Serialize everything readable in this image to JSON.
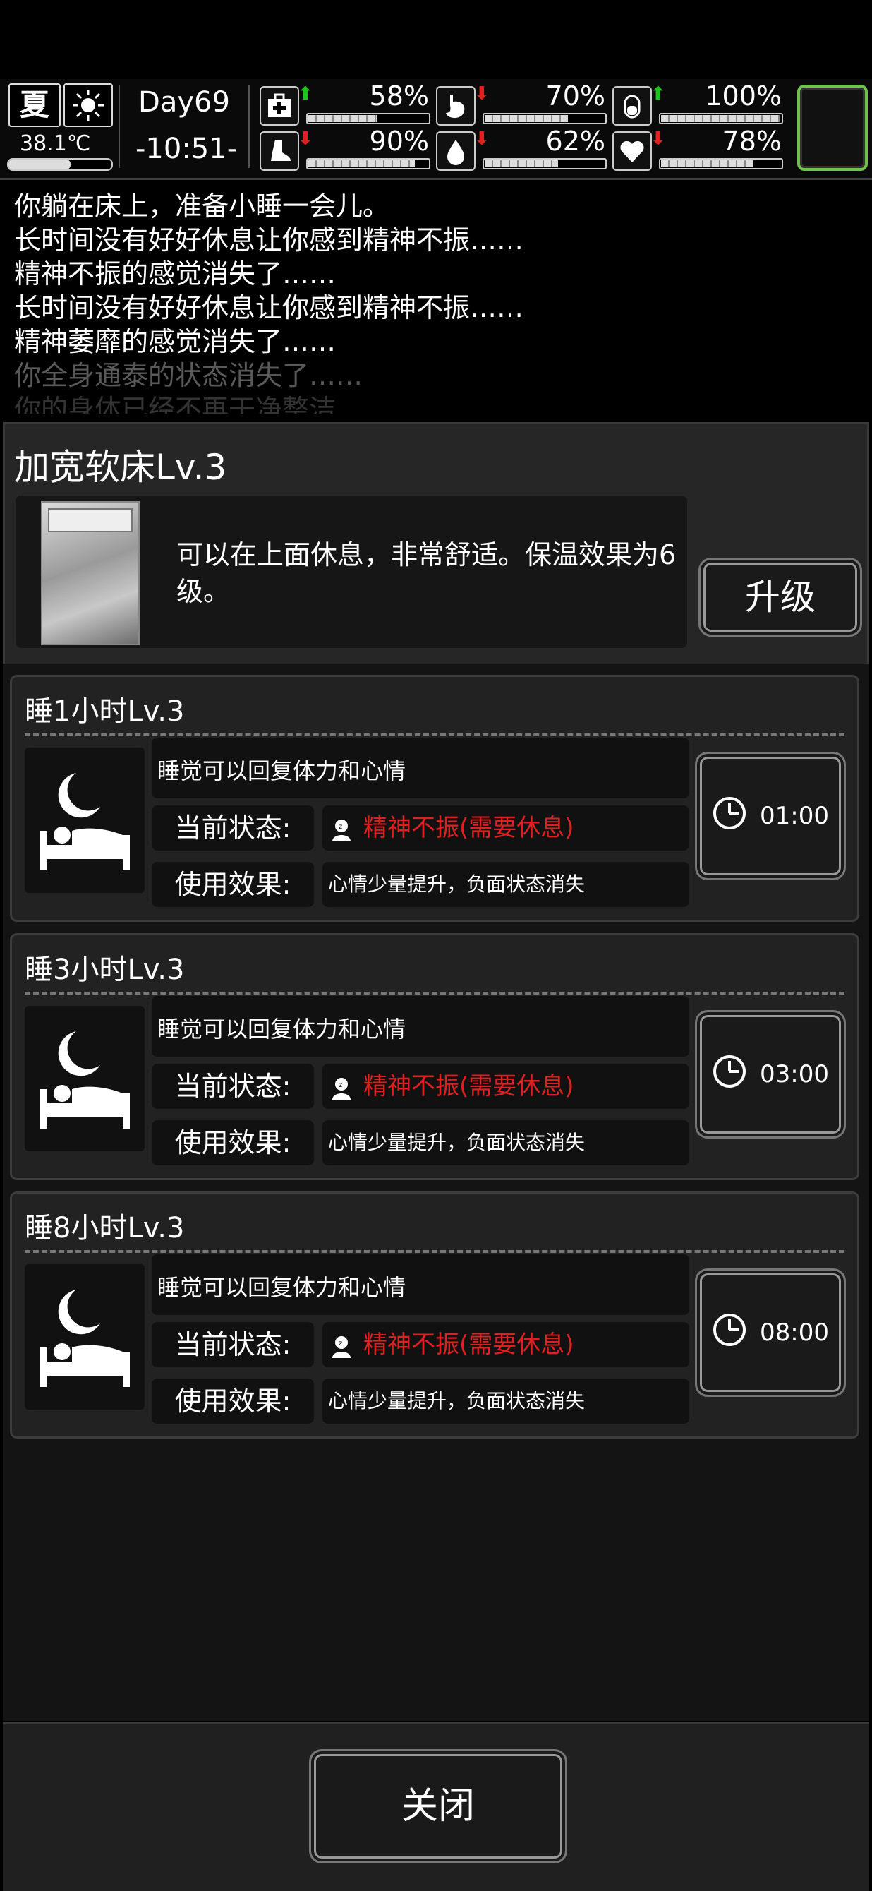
{
  "status": {
    "season": "夏",
    "weather_icon": "sun-icon",
    "temperature": "38.1℃",
    "temperature_level": 0.6,
    "day": "Day69",
    "time": "-10:51-",
    "stats": [
      {
        "icon": "medkit-icon",
        "trend": "up",
        "value": "58%",
        "level": 0.58
      },
      {
        "icon": "stomach-icon",
        "trend": "down",
        "value": "70%",
        "level": 0.7
      },
      {
        "icon": "bladder-icon",
        "trend": "up",
        "value": "100%",
        "level": 1.0
      },
      {
        "icon": "foot-icon",
        "trend": "down",
        "value": "90%",
        "level": 0.9
      },
      {
        "icon": "water-drop-icon",
        "trend": "down",
        "value": "62%",
        "level": 0.62
      },
      {
        "icon": "heart-icon",
        "trend": "down",
        "value": "78%",
        "level": 0.78
      }
    ],
    "trend_up": "⬆",
    "trend_down": "⬇"
  },
  "log": {
    "lines": [
      "你躺在床上，准备小睡一会儿。",
      "长时间没有好好休息让你感到精神不振……",
      "精神不振的感觉消失了……",
      "长时间没有好好休息让你感到精神不振……",
      "精神萎靡的感觉消失了……",
      "你全身通泰的状态消失了……",
      "你的身体已经不再干净整洁……"
    ]
  },
  "item": {
    "title": "加宽软床Lv.3",
    "description": "可以在上面休息，非常舒适。保温效果为6级。",
    "upgrade_label": "升级"
  },
  "actions": [
    {
      "name": "睡1小时Lv.3",
      "desc": "睡觉可以回复体力和心情",
      "status_label": "当前状态:",
      "status_value": "精神不振(需要休息)",
      "effect_label": "使用效果:",
      "effect_value": "心情少量提升，负面状态消失",
      "time": "01:00"
    },
    {
      "name": "睡3小时Lv.3",
      "desc": "睡觉可以回复体力和心情",
      "status_label": "当前状态:",
      "status_value": "精神不振(需要休息)",
      "effect_label": "使用效果:",
      "effect_value": "心情少量提升，负面状态消失",
      "time": "03:00"
    },
    {
      "name": "睡8小时Lv.3",
      "desc": "睡觉可以回复体力和心情",
      "status_label": "当前状态:",
      "status_value": "精神不振(需要休息)",
      "effect_label": "使用效果:",
      "effect_value": "心情少量提升，负面状态消失",
      "time": "08:00"
    }
  ],
  "colors": {
    "status_text": "#e02020",
    "stat_up": "#1ec31e",
    "stat_down": "#e02020",
    "menu_border": "#6fc24a"
  },
  "close_label": "关闭"
}
